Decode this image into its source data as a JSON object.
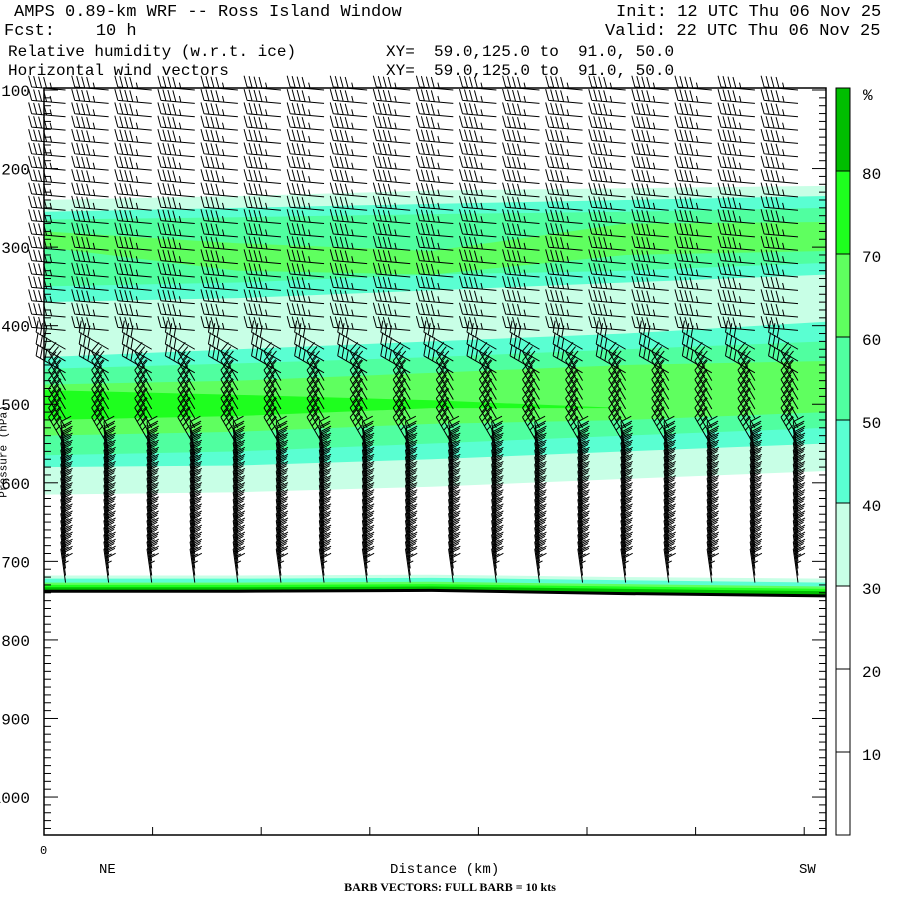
{
  "header": {
    "title": "AMPS 0.89-km WRF -- Ross Island Window",
    "fcst": "Fcst:    10 h",
    "init": "Init: 12 UTC Thu 06 Nov 25",
    "valid": "Valid: 22 UTC Thu 06 Nov 25",
    "field1": "Relative humidity (w.r.t. ice)",
    "field2": "Horizontal wind vectors",
    "xy1": "XY=  59.0,125.0 to  91.0, 50.0",
    "xy2": "XY=  59.0,125.0 to  91.0, 50.0"
  },
  "footer": {
    "x_start": "0",
    "left_dir": "NE",
    "right_dir": "SW",
    "xlabel": "Distance (km)",
    "barb_note": "BARB VECTORS:  FULL BARB = 10 kts"
  },
  "chart_data": {
    "type": "heatmap",
    "title": "Relative humidity (w.r.t. ice) / Horizontal wind vectors",
    "xlabel": "Distance (km)",
    "ylabel": "Pressure (hPa)",
    "xlim": [
      0,
      72.6
    ],
    "ylim": [
      1050,
      100
    ],
    "yticks": [
      100,
      200,
      300,
      400,
      500,
      600,
      700,
      800,
      900,
      1000
    ],
    "colorbar": {
      "unit": "%",
      "levels": [
        10,
        20,
        30,
        40,
        50,
        60,
        70,
        80
      ],
      "colors": [
        "#ffffff",
        "#ffffff",
        "#ffffff",
        "#c8ffe6",
        "#5affd2",
        "#50ffa0",
        "#5fff5f",
        "#1eff1e",
        "#00be00"
      ]
    },
    "x_nodes_km": [
      0,
      18,
      36,
      54,
      72.6
    ],
    "rh_regions": [
      {
        "class": 3,
        "range": "30-40",
        "top": [
          240,
          235,
          228,
          225,
          222
        ],
        "bottom": [
          615,
          612,
          605,
          595,
          585
        ]
      },
      {
        "class": 3,
        "range": "30-40",
        "top": [
          718,
          718,
          717,
          720,
          722
        ],
        "bottom": [
          740,
          740,
          740,
          743,
          746
        ]
      },
      {
        "class": 4,
        "range": "40-50",
        "top": [
          255,
          250,
          245,
          240,
          235
        ],
        "bottom": [
          370,
          365,
          355,
          345,
          335
        ]
      },
      {
        "class": 4,
        "range": "40-50",
        "top": [
          440,
          430,
          420,
          410,
          395
        ],
        "bottom": [
          580,
          578,
          570,
          560,
          550
        ]
      },
      {
        "class": 4,
        "range": "40-50",
        "top": [
          722,
          722,
          721,
          724,
          727
        ],
        "bottom": [
          740,
          740,
          740,
          743,
          746
        ]
      },
      {
        "class": 5,
        "range": "50-60",
        "top": [
          265,
          262,
          258,
          255,
          250
        ],
        "bottom": [
          350,
          345,
          335,
          330,
          320
        ]
      },
      {
        "class": 5,
        "range": "50-60",
        "top": [
          455,
          448,
          440,
          430,
          420
        ],
        "bottom": [
          565,
          560,
          550,
          540,
          530
        ]
      },
      {
        "class": 6,
        "range": "60-70",
        "top": [
          280,
          295,
          305,
          270,
          268
        ],
        "bottom": [
          300,
          330,
          335,
          310,
          305
        ]
      },
      {
        "class": 6,
        "range": "60-70",
        "top": [
          475,
          470,
          460,
          450,
          445
        ],
        "bottom": [
          540,
          535,
          525,
          520,
          510
        ]
      },
      {
        "class": 6,
        "range": "60-70",
        "top": [
          727,
          727,
          726,
          729,
          732
        ],
        "bottom": [
          740,
          740,
          740,
          743,
          746
        ]
      },
      {
        "class": 7,
        "range": "70-80",
        "top": [
          482,
          488,
          495,
          505,
          505
        ],
        "bottom": [
          520,
          515,
          505,
          505,
          505
        ]
      },
      {
        "class": 7,
        "range": "70-80",
        "top": [
          730,
          730,
          729,
          732,
          735
        ],
        "bottom": [
          740,
          740,
          740,
          743,
          746
        ]
      },
      {
        "class": 8,
        "range": ">80",
        "top": [
          733,
          733,
          732,
          735,
          738
        ],
        "bottom": [
          740,
          740,
          740,
          743,
          746
        ]
      }
    ],
    "surface_pressure": [
      738,
      738,
      737,
      741,
      744
    ],
    "barb_columns_km": [
      2,
      6,
      10,
      14,
      18,
      22,
      26,
      30,
      34,
      38,
      42,
      46,
      50,
      54,
      58,
      62,
      66,
      70
    ],
    "wind_profile": [
      {
        "p_top": 100,
        "p_bottom": 420,
        "step": 17,
        "dir": 275,
        "speed_kts": 35
      },
      {
        "p_top": 430,
        "p_bottom": 460,
        "step": 15,
        "dir": 300,
        "speed_kts": 30
      },
      {
        "p_top": 470,
        "p_bottom": 560,
        "step": 12,
        "dir": 330,
        "speed_kts": 25
      },
      {
        "p_top": 565,
        "p_bottom": 730,
        "step": 9,
        "dir": 352,
        "speed_kts": 25
      }
    ]
  }
}
